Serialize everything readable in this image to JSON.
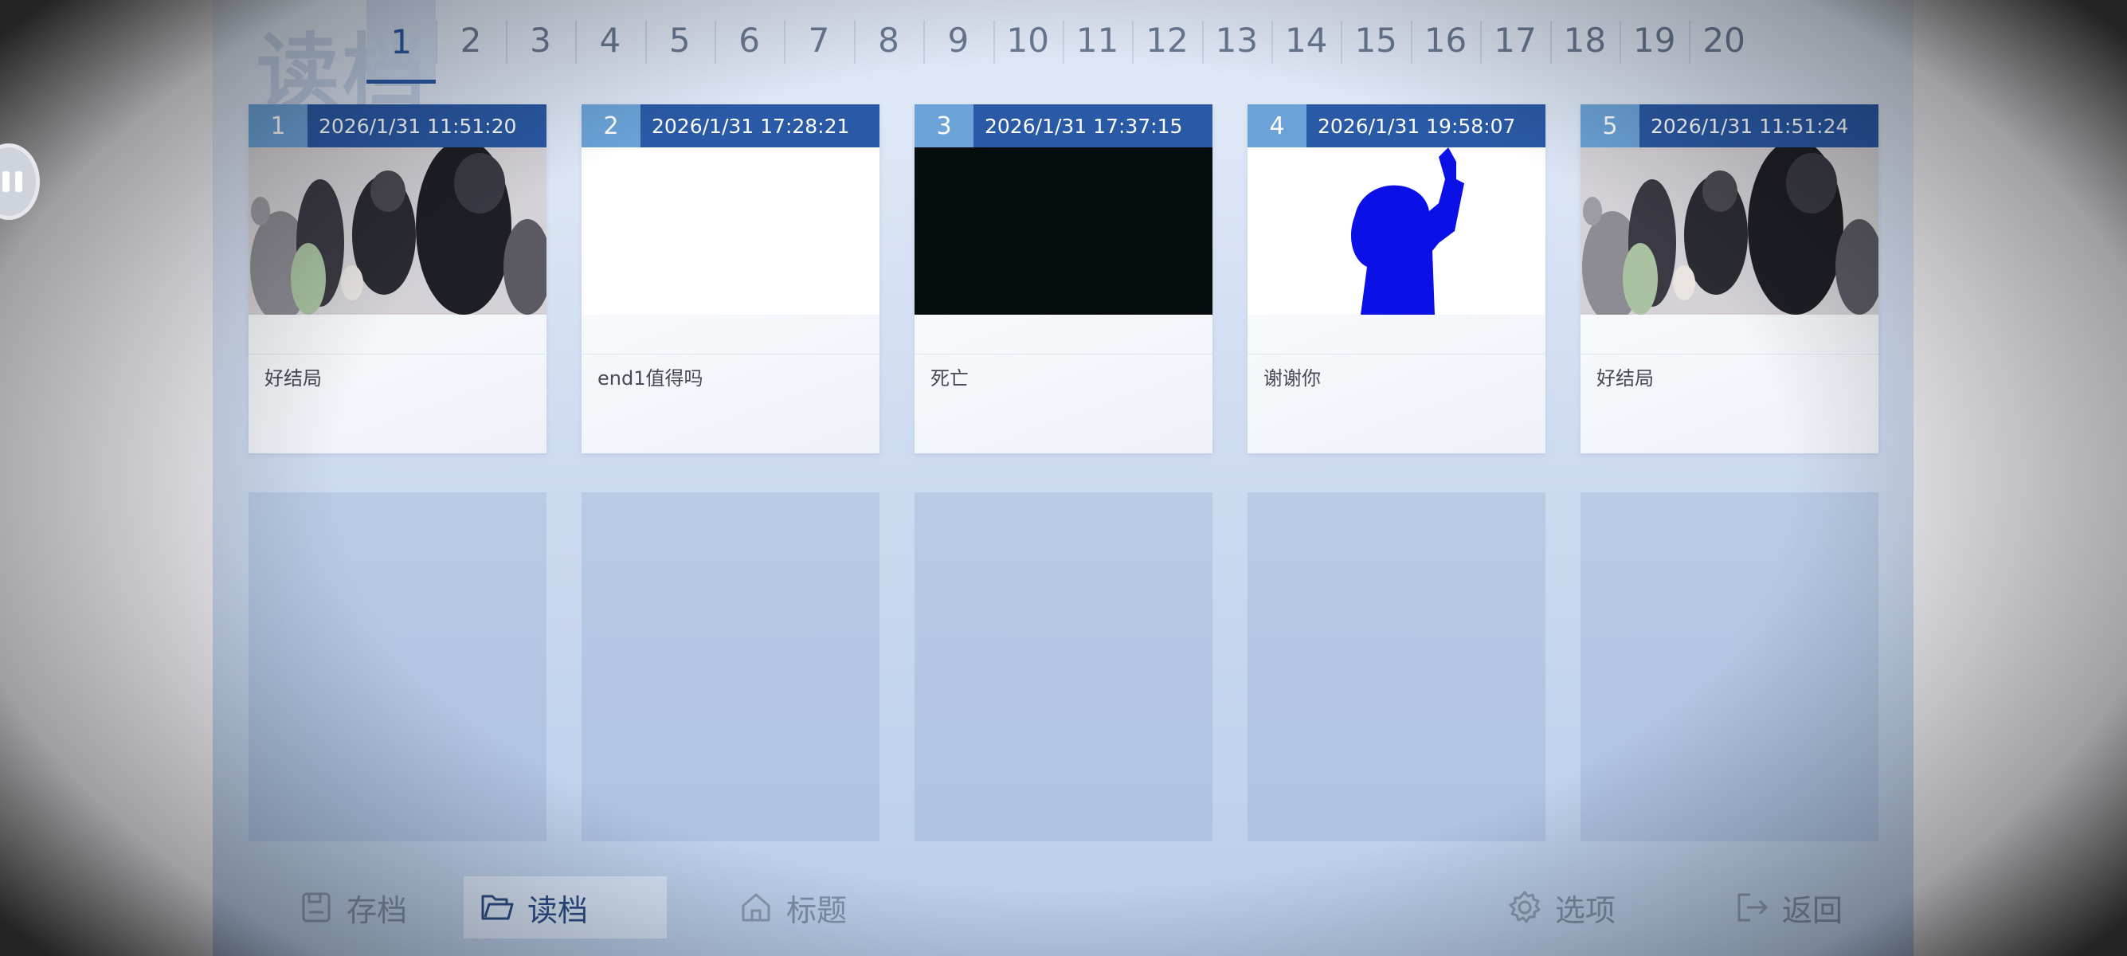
{
  "header": {
    "title": "读档",
    "pages": [
      "1",
      "2",
      "3",
      "4",
      "5",
      "6",
      "7",
      "8",
      "9",
      "10",
      "11",
      "12",
      "13",
      "14",
      "15",
      "16",
      "17",
      "18",
      "19",
      "20"
    ],
    "active_page": "1"
  },
  "slots": [
    {
      "num": "1",
      "datetime": "2026/1/31 11:51:20",
      "caption": "好结局",
      "thumb": "scene-illustration"
    },
    {
      "num": "2",
      "datetime": "2026/1/31 17:28:21",
      "caption": "end1值得吗",
      "thumb": "blank-white"
    },
    {
      "num": "3",
      "datetime": "2026/1/31 17:37:15",
      "caption": "死亡",
      "thumb": "blank-black"
    },
    {
      "num": "4",
      "datetime": "2026/1/31 19:58:07",
      "caption": "谢谢你",
      "thumb": "blue-silhouette"
    },
    {
      "num": "5",
      "datetime": "2026/1/31 11:51:24",
      "caption": "好结局",
      "thumb": "scene-illustration"
    }
  ],
  "empty_slots": 5,
  "nav": {
    "save": "存档",
    "load": "读档",
    "title": "标题",
    "options": "选项",
    "back": "返回"
  },
  "colors": {
    "slot_header": "#2a5aa6",
    "slot_number": "#6ba3d8",
    "active_tab": "#2b5ca9",
    "silhouette": "#0a10e6"
  },
  "icons": {
    "save": "save-icon",
    "load": "folder-open-icon",
    "title": "home-icon",
    "options": "gear-icon",
    "back": "exit-icon",
    "overlay": "pause-icon"
  }
}
